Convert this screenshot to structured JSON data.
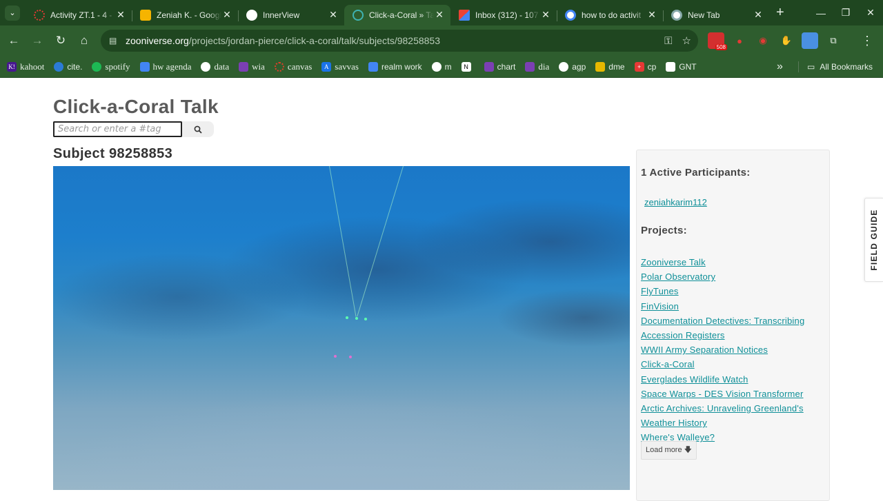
{
  "browser": {
    "tabs": [
      {
        "title": "Activity ZT.1 - 4 - ",
        "favicon_color": "#e53935"
      },
      {
        "title": "Zeniah K. - Google",
        "favicon_color": "#f6b400"
      },
      {
        "title": "InnerView",
        "favicon_color": "#ffffff"
      },
      {
        "title": "Click-a-Coral » Ta",
        "favicon_color": "#3fb3b3"
      },
      {
        "title": "Inbox (312) - 107",
        "favicon_color": "#ea4335"
      },
      {
        "title": "how to do activit",
        "favicon_color": "#4285f4"
      },
      {
        "title": "New Tab",
        "favicon_color": "#ffffff"
      }
    ],
    "url_host": "zooniverse.org",
    "url_path": "/projects/jordan-pierce/click-a-coral/talk/subjects/98258853",
    "ext_badge": "508",
    "bookmarks": [
      {
        "label": "kahoot",
        "color": "#46178f",
        "icon": "K!"
      },
      {
        "label": "cite.",
        "color": "#2b7bd6",
        "icon": ""
      },
      {
        "label": "spotify",
        "color": "#1db954",
        "icon": ""
      },
      {
        "label": "hw agenda",
        "color": "#4285f4",
        "icon": ""
      },
      {
        "label": "data",
        "color": "#ffffff",
        "icon": ""
      },
      {
        "label": "wia",
        "color": "#7b3fb3",
        "icon": ""
      },
      {
        "label": "canvas",
        "color": "#e13e2b",
        "icon": ""
      },
      {
        "label": "savvas",
        "color": "#1a73e8",
        "icon": ""
      },
      {
        "label": "realm work",
        "color": "#4285f4",
        "icon": ""
      },
      {
        "label": "m",
        "color": "#ffffff",
        "icon": ""
      },
      {
        "label": "",
        "color": "#ffffff",
        "icon": "N"
      },
      {
        "label": "chart",
        "color": "#7b3fb3",
        "icon": ""
      },
      {
        "label": "dia",
        "color": "#7b3fb3",
        "icon": ""
      },
      {
        "label": "agp",
        "color": "#ffffff",
        "icon": ""
      },
      {
        "label": "dme",
        "color": "#e6b800",
        "icon": ""
      },
      {
        "label": "cp",
        "color": "#e53935",
        "icon": ""
      },
      {
        "label": "GNT",
        "color": "#ffffff",
        "icon": ""
      }
    ],
    "all_bookmarks": "All Bookmarks"
  },
  "page": {
    "title": "Click-a-Coral Talk",
    "search_placeholder": "Search or enter a #tag",
    "subject_title": "Subject 98258853"
  },
  "sidebar": {
    "participants_heading": "1 Active Participants:",
    "participants": [
      "zeniahkarim112"
    ],
    "projects_heading": "Projects:",
    "projects": [
      "Zooniverse Talk",
      "Polar Observatory",
      "FlyTunes",
      "FinVision",
      "Documentation Detectives: Transcribing",
      "Accession Registers",
      "WWII Army Separation Notices",
      "Click-a-Coral",
      "Everglades Wildlife Watch",
      "Space Warps - DES Vision Transformer",
      "Arctic Archives: Unraveling Greenland's",
      "Weather History",
      "Where's Walleye?"
    ],
    "load_more": "Load more"
  },
  "field_guide": "FIELD GUIDE"
}
